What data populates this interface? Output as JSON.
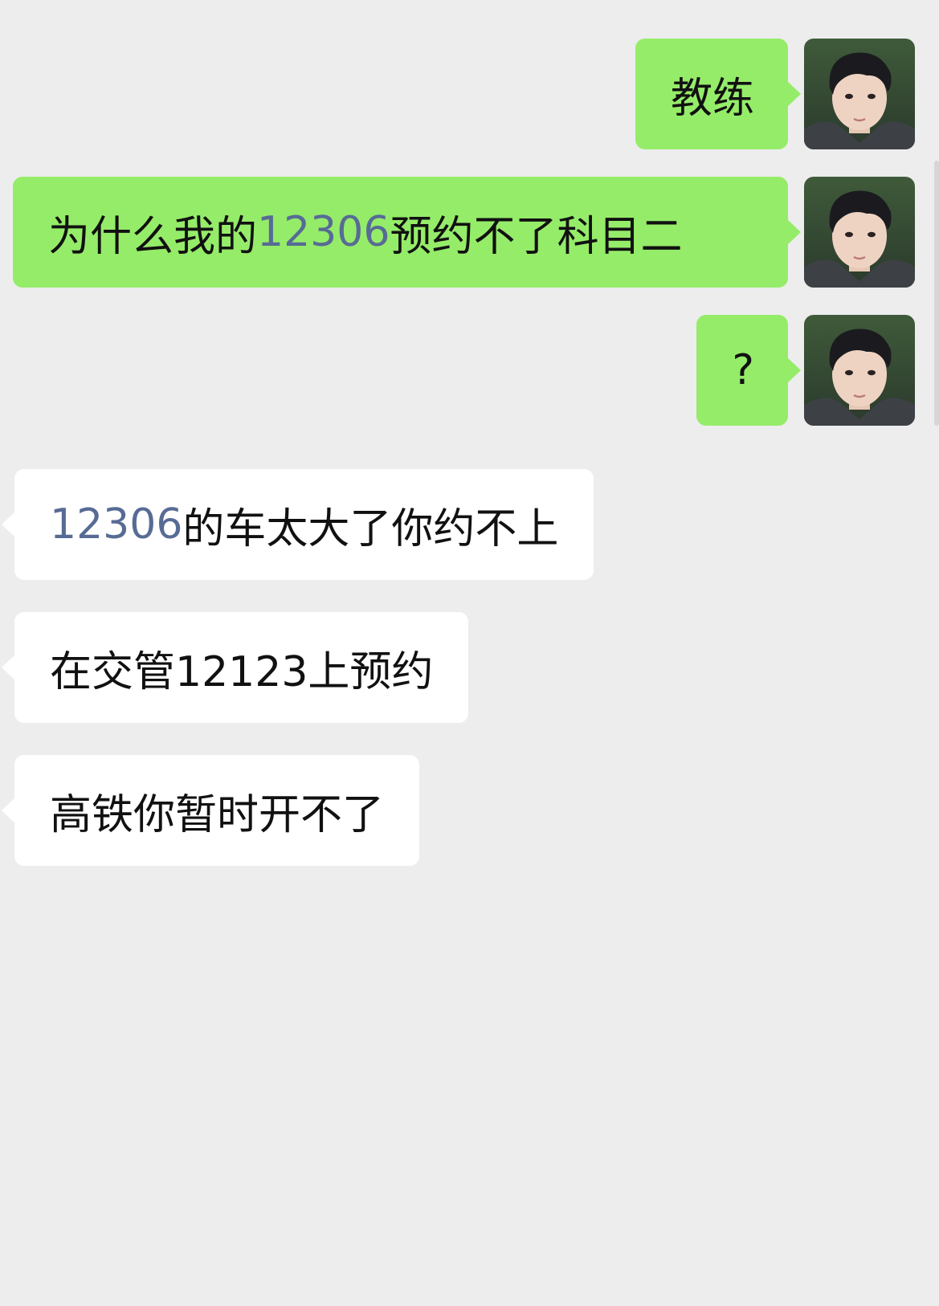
{
  "messages": [
    {
      "side": "out",
      "parts": [
        {
          "text": "教练"
        }
      ]
    },
    {
      "side": "out",
      "parts": [
        {
          "text": "为什么我的"
        },
        {
          "text": "12306",
          "link": true
        },
        {
          "text": "预约不了科目二"
        }
      ]
    },
    {
      "side": "out",
      "parts": [
        {
          "text": "?"
        }
      ]
    },
    {
      "side": "in",
      "parts": [
        {
          "text": "12306",
          "link": true
        },
        {
          "text": "的车太大了你约不上"
        }
      ]
    },
    {
      "side": "in",
      "parts": [
        {
          "text": "在交管12123上预约"
        }
      ]
    },
    {
      "side": "in",
      "parts": [
        {
          "text": "高铁你暂时开不了"
        }
      ]
    }
  ],
  "colors": {
    "background": "#ededed",
    "outgoing_bubble": "#95ec69",
    "incoming_bubble": "#ffffff",
    "link": "#576b95"
  },
  "icons": {
    "avatar": "avatar-photo"
  }
}
